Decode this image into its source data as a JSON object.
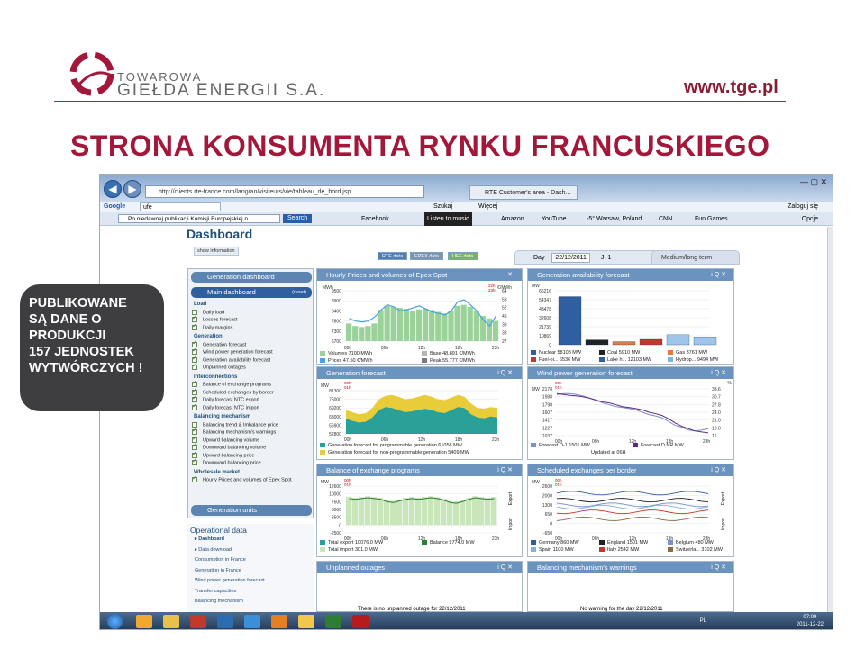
{
  "header": {
    "logo_line1": "TOWAROWA",
    "logo_line2": "GIEŁDA ENERGII S.A.",
    "website": "www.tge.pl",
    "slide_title": "STRONA KONSUMENTA RYNKU FRANCUSKIEGO",
    "brand_color": "#a2173a"
  },
  "callout": {
    "lines": [
      "PUBLIKOWANE",
      "SĄ DANE O",
      "PRODUKCJI",
      "157 JEDNOSTEK",
      "WYTWÓRCZYCH !"
    ]
  },
  "browser": {
    "url": "http://clients.rte-france.com/lang/an/visiteurs/vie/tableau_de_bord.jsp",
    "tab_title": "RTE Customer's area - Dash...",
    "search_engine": "Google",
    "search_value": "ufe",
    "search_menu": "Szukaj",
    "more_menu": "Więcej",
    "login": "Zaloguj się",
    "options": "Opcje",
    "toolbar_search": "Po niedawnej publikacji Komisji Europejskiej n",
    "toolbar_search_btn": "Search",
    "facebook": "Facebook",
    "listen": "Listen to music",
    "amazon": "Amazon",
    "youtube": "YouTube",
    "weather": "-5° Warsaw, Poland",
    "cnn": "CNN",
    "fun_games": "Fun Games"
  },
  "dashboard": {
    "title": "Dashboard",
    "show_information": "show information",
    "btn_rte": "RTE data",
    "btn_epex": "EPEX data",
    "btn_ufe": "UFE data",
    "day_label": "Day",
    "date": "22/12/2011",
    "j1": "J+1",
    "medium_term": "Medium/long term"
  },
  "sidebar": {
    "generation_dashboard": "Generation dashboard",
    "main_dashboard": "Main dashboard",
    "reset": "(reset)",
    "sections": [
      {
        "title": "Load",
        "items": [
          {
            "label": "Daily load",
            "checked": false
          },
          {
            "label": "Losses forecast",
            "checked": true
          },
          {
            "label": "Daily margins",
            "checked": true
          }
        ]
      },
      {
        "title": "Generation",
        "items": [
          {
            "label": "Generation forecast",
            "checked": true
          },
          {
            "label": "Wind power generation forecast",
            "checked": true
          },
          {
            "label": "Generation availability forecast",
            "checked": true
          },
          {
            "label": "Unplanned outages",
            "checked": true
          }
        ]
      },
      {
        "title": "Interconnections",
        "items": [
          {
            "label": "Balance of exchange programs",
            "checked": true
          },
          {
            "label": "Scheduled exchanges by border",
            "checked": true
          },
          {
            "label": "Daily forecast NTC export",
            "checked": true
          },
          {
            "label": "Daily forecast NTC import",
            "checked": true
          }
        ]
      },
      {
        "title": "Balancing mechanism",
        "items": [
          {
            "label": "Balancing trend & Imbalance price",
            "checked": false
          },
          {
            "label": "Balancing mechanism's warnings",
            "checked": true
          },
          {
            "label": "Upward balancing volume",
            "checked": true
          },
          {
            "label": "Downward balancing volume",
            "checked": true
          },
          {
            "label": "Upward balancing price",
            "checked": true
          },
          {
            "label": "Downward balancing price",
            "checked": true
          }
        ]
      },
      {
        "title": "Wholesale market",
        "items": [
          {
            "label": "Hourly Prices and volumes of Epex Spot",
            "checked": true
          }
        ]
      }
    ],
    "generation_units": "Generation units"
  },
  "operational": {
    "title": "Operational data",
    "items": [
      "Dashboard",
      "Data download",
      "Consumption in France",
      "Generation in France",
      "Wind power generation forecast",
      "Transfer capacities",
      "Balancing mechanism"
    ]
  },
  "panels": {
    "epex": {
      "title": "Hourly Prices and volumes of Epex Spot",
      "unit_left": "MWh",
      "unit_right": "€/MWh",
      "y_left": [
        "9500",
        "8900",
        "8400",
        "7800",
        "7300",
        "6700"
      ],
      "y_right": [
        "64",
        "58",
        "52",
        "46",
        "39",
        "33",
        "27"
      ],
      "x": [
        "00h",
        "06h",
        "12h",
        "18h",
        "23h"
      ],
      "legend": [
        {
          "label": "Volumes",
          "value": "7100",
          "unit": "MWh",
          "color": "#9bd29a"
        },
        {
          "label": "Base",
          "value": "48.891",
          "unit": "€/MWh",
          "color": "#b7b7b7"
        },
        {
          "label": "Prices",
          "value": "47.50",
          "unit": "€/MWh",
          "color": "#4aa3df"
        },
        {
          "label": "Peak",
          "value": "55.777",
          "unit": "€/MWh",
          "color": "#7a7a7a"
        }
      ],
      "marker1": "22h",
      "marker2": "23h"
    },
    "availability": {
      "title": "Generation availability forecast",
      "unit": "MW",
      "y": [
        "65216",
        "54347",
        "43478",
        "32608",
        "21739",
        "10869",
        "0"
      ],
      "legend": [
        {
          "label": "Nuclear",
          "value": "58108",
          "unit": "MW",
          "color": "#2f5f9e"
        },
        {
          "label": "Coal",
          "value": "5910",
          "unit": "MW",
          "color": "#222222"
        },
        {
          "label": "Gas",
          "value": "3761",
          "unit": "MW",
          "color": "#e07b39"
        },
        {
          "label": "Fuel-oi...",
          "value": "6536",
          "unit": "MW",
          "color": "#c0392b"
        },
        {
          "label": "Lake h...",
          "value": "12103",
          "unit": "MW",
          "color": "#2f5f9e"
        },
        {
          "label": "Hydrop...",
          "value": "9494",
          "unit": "MW",
          "color": "#7fb3e0"
        }
      ],
      "bars": [
        58108,
        5910,
        3761,
        6536,
        12103,
        9494
      ],
      "bar_colors": [
        "#2f5f9e",
        "#222222",
        "#e07b39",
        "#c0392b",
        "#9ec6ea",
        "#9ec6ea"
      ]
    },
    "genforecast": {
      "title": "Generation forecast",
      "unit": "MW",
      "y": [
        "81300",
        "75000",
        "69200",
        "63000",
        "56900",
        "52800"
      ],
      "x": [
        "00h",
        "06h",
        "12h",
        "18h",
        "23h"
      ],
      "marker1": "00h",
      "marker2": "01h",
      "legend": [
        {
          "label": "Generation forecast for programmable generation",
          "value": "61058",
          "unit": "MW",
          "color": "#2aa198"
        },
        {
          "label": "Generation forecast for non-programmable generation",
          "value": "5409",
          "unit": "MW",
          "color": "#e8cc3a"
        }
      ]
    },
    "wind": {
      "title": "Wind power generation forecast",
      "unit_left": "MW",
      "unit_right": "%",
      "y_left": [
        "2178",
        "1988",
        "1798",
        "1607",
        "1417",
        "1227",
        "1037"
      ],
      "y_right": [
        "33.6",
        "30.7",
        "27.8",
        "24.0",
        "21.0",
        "18.0",
        "16"
      ],
      "x": [
        "00h",
        "06h",
        "12h",
        "18h",
        "23h"
      ],
      "marker1": "00h",
      "marker2": "01h",
      "legend": [
        {
          "label": "Forecast D-1",
          "value": "1501",
          "unit": "MW",
          "color": "#7b8fc9"
        },
        {
          "label": "Forecast D",
          "value": "NR",
          "unit": "MW",
          "color": "#5b2a86"
        }
      ],
      "updated": "Updated at 06H"
    },
    "balance": {
      "title": "Balance of exchange programs",
      "unit": "MW",
      "y": [
        "12600",
        "10000",
        "7500",
        "5000",
        "2500",
        "0",
        "-2500"
      ],
      "x": [
        "00h",
        "06h",
        "12h",
        "18h",
        "23h"
      ],
      "marker1": "00h",
      "marker2": "01h",
      "export": "Export",
      "import": "Import",
      "legend": [
        {
          "label": "Total export",
          "value": "10076.0",
          "unit": "MW",
          "color": "#2aa198"
        },
        {
          "label": "Balance",
          "value": "9774.0",
          "unit": "MW",
          "color": "#2e7d32"
        },
        {
          "label": "Total import",
          "value": "301.0",
          "unit": "MW",
          "color": "#c9e6bb"
        }
      ]
    },
    "scheduled": {
      "title": "Scheduled exchanges per border",
      "unit": "MW",
      "y": [
        "2600",
        "2000",
        "1300",
        "650",
        "0",
        "-650"
      ],
      "x": [
        "00h",
        "06h",
        "12h",
        "18h",
        "23h"
      ],
      "marker1": "00h",
      "marker2": "01h",
      "export": "Export",
      "import": "Import",
      "legend": [
        {
          "label": "Germany",
          "value": "860",
          "unit": "MW",
          "color": "#2f5f9e"
        },
        {
          "label": "England",
          "value": "1501",
          "unit": "MW",
          "color": "#222222"
        },
        {
          "label": "Belgium",
          "value": "480",
          "unit": "MW",
          "color": "#7b8fc9"
        },
        {
          "label": "Spain",
          "value": "1100",
          "unit": "MW",
          "color": "#7fb3e0"
        },
        {
          "label": "Italy",
          "value": "2542",
          "unit": "MW",
          "color": "#c0392b"
        },
        {
          "label": "Switzerla...",
          "value": "3102",
          "unit": "MW",
          "color": "#8b6a4a"
        }
      ]
    },
    "outages": {
      "title": "Unplanned outages",
      "note": "There is no unplanned outage for 22/12/2011"
    },
    "warnings": {
      "title": "Balancing mechanism's warnings",
      "note": "No warning for the day 22/12/2011"
    }
  },
  "taskbar": {
    "lang": "PL",
    "time": "07:09",
    "date": "2011-12-22"
  }
}
